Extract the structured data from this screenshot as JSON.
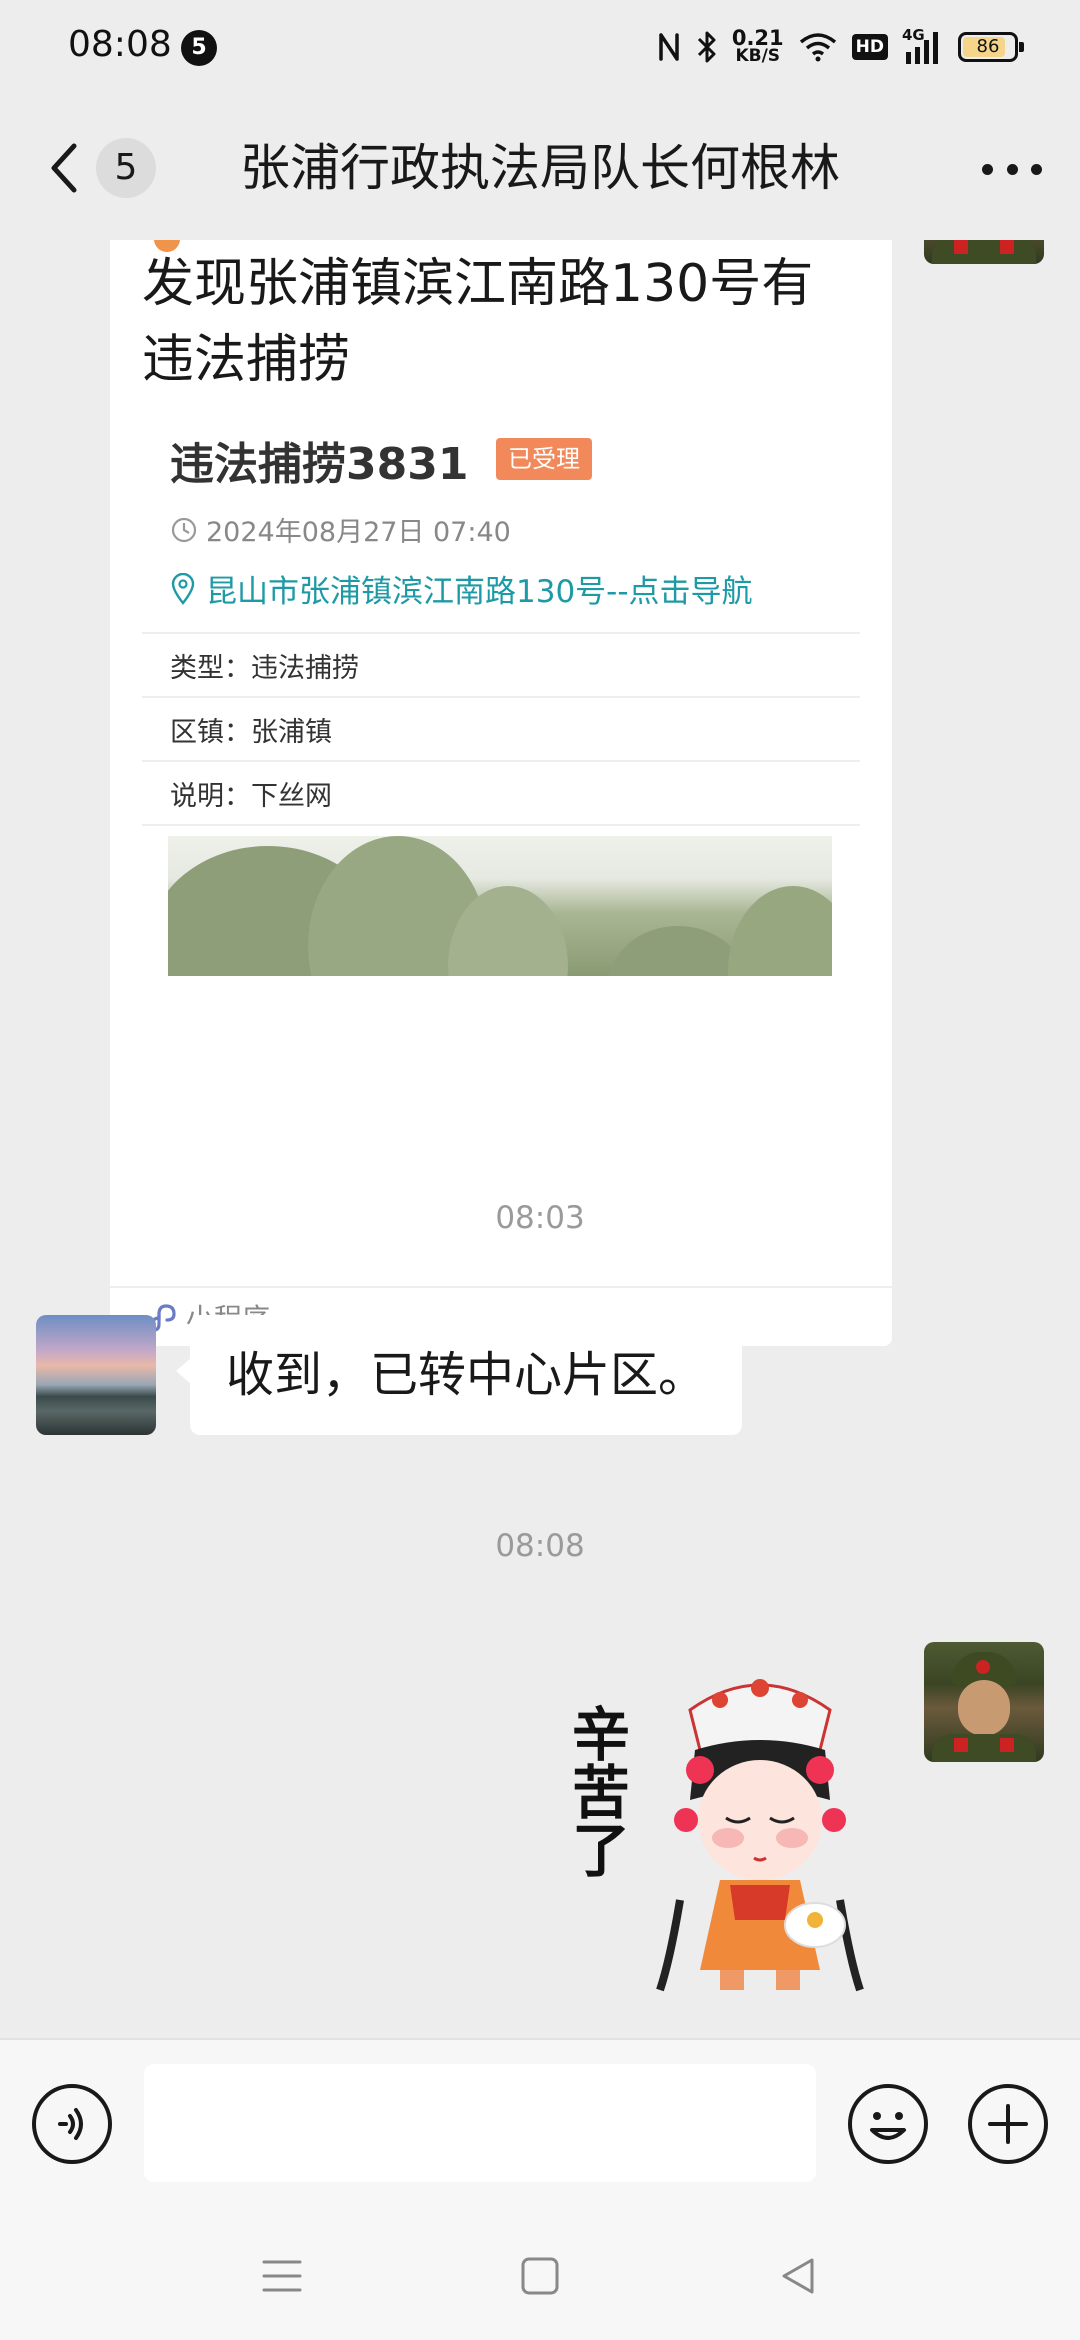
{
  "status_bar": {
    "time": "08:08",
    "notification_count": "5",
    "net_speed_value": "0.21",
    "net_speed_unit": "KB/S",
    "hd_label": "HD",
    "network_type": "4G",
    "battery_percent": "86",
    "battery_level": 0.86
  },
  "header": {
    "unread_count": "5",
    "title": "张浦行政执法局队长何根林"
  },
  "messages": {
    "card": {
      "title": "发现张浦镇滨江南路130号有违法捕捞",
      "case_name": "违法捕捞3831",
      "status": "已受理",
      "datetime": "2024年08月27日 07:40",
      "address": "昆山市张浦镇滨江南路130号--点击导航",
      "type_label": "类型：",
      "type_value": "违法捕捞",
      "district_label": "区镇：",
      "district_value": "张浦镇",
      "note_label": "说明：",
      "note_value": "下丝网",
      "footer_label": "小程序"
    },
    "time_1": "08:03",
    "reply_text": "收到，已转中心片区。",
    "time_2": "08:08",
    "sticker_text": "辛苦了"
  },
  "input": {
    "value": ""
  },
  "colors": {
    "background": "#ededed",
    "status_tag": "#f2895a",
    "link": "#1e9aa6"
  }
}
